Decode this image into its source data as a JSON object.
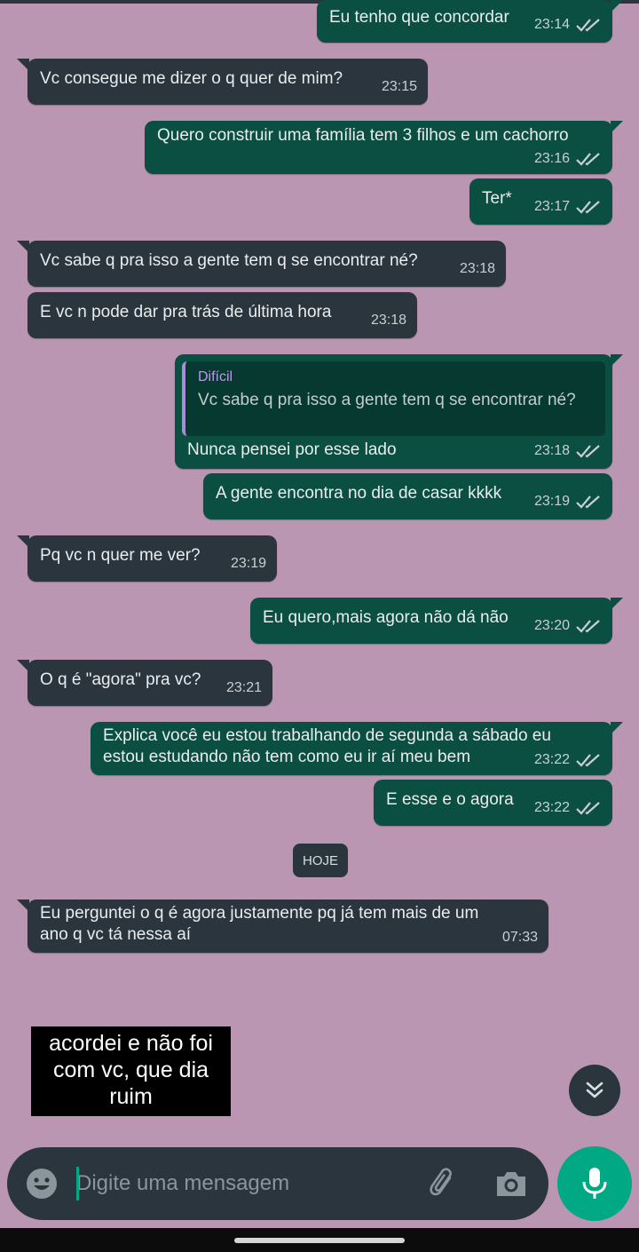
{
  "messages": [
    {
      "dir": "out",
      "text": "Eu tenho que concordar",
      "time": "23:14",
      "read": true
    },
    {
      "dir": "in",
      "text": "Vc consegue me dizer o q quer de mim?",
      "time": "23:15"
    },
    {
      "dir": "out",
      "text": "Quero construir uma família tem 3 filhos e um cachorro",
      "time": "23:16",
      "read": true
    },
    {
      "dir": "out",
      "text": "Ter*",
      "time": "23:17",
      "read": true
    },
    {
      "dir": "in",
      "text": "Vc sabe q pra isso a gente tem q se encontrar né?",
      "time": "23:18"
    },
    {
      "dir": "in",
      "text": "E vc n pode dar pra trás de última hora",
      "time": "23:18"
    },
    {
      "dir": "out",
      "text": "Nunca pensei por esse lado",
      "time": "23:18",
      "read": true,
      "reply": {
        "author": "Difícil",
        "text": "Vc sabe q pra isso a gente tem q se encontrar né?"
      }
    },
    {
      "dir": "out",
      "text": "A gente encontra no dia de casar kkkk",
      "time": "23:19",
      "read": true
    },
    {
      "dir": "in",
      "text": "Pq vc n quer me ver?",
      "time": "23:19"
    },
    {
      "dir": "out",
      "text": "Eu quero,mais agora não dá não",
      "time": "23:20",
      "read": true
    },
    {
      "dir": "in",
      "text": "O q é \"agora\" pra vc?",
      "time": "23:21"
    },
    {
      "dir": "out",
      "lines": [
        "Explica você eu estou trabalhando de segunda a sábado eu",
        "estou estudando não tem como eu ir aí meu bem"
      ],
      "time": "23:22",
      "read": true
    },
    {
      "dir": "out",
      "text": "E esse e o agora",
      "time": "23:22",
      "read": true
    },
    {
      "dir": "in",
      "lines": [
        "Eu perguntei o q é agora justamente pq já tem mais de um",
        "ano q vc tá nessa aí"
      ],
      "time": "07:33"
    }
  ],
  "day_separator": "HOJE",
  "caption": "acordei e não foi com vc, que dia ruim",
  "composer": {
    "placeholder": "Digite uma mensagem"
  },
  "icons": {
    "emoji": "emoji-icon",
    "attach": "paperclip-icon",
    "camera": "camera-icon",
    "mic": "microphone-icon",
    "scroll": "double-chevron-down-icon",
    "ticks": "double-check-icon"
  },
  "colors": {
    "background": "#bb96b3",
    "incoming": "#2b353d",
    "outgoing": "#0b4e42",
    "accent": "#00a884",
    "reply_author": "#b79be6"
  }
}
